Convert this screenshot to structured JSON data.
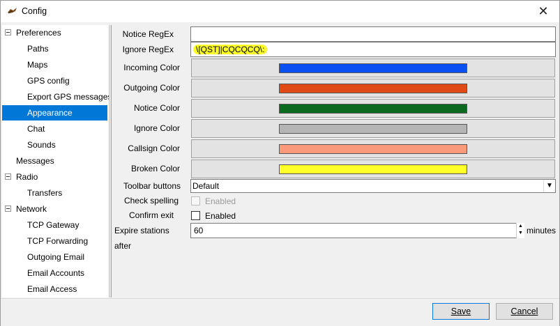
{
  "window": {
    "title": "Config",
    "close_symbol": "✕"
  },
  "tree": [
    {
      "label": "Preferences",
      "expander": true,
      "selected": false
    },
    {
      "label": "Paths",
      "expander": false,
      "selected": false
    },
    {
      "label": "Maps",
      "expander": false,
      "selected": false
    },
    {
      "label": "GPS config",
      "expander": false,
      "selected": false
    },
    {
      "label": "Export GPS messages",
      "expander": false,
      "selected": false
    },
    {
      "label": "Appearance",
      "expander": false,
      "selected": true
    },
    {
      "label": "Chat",
      "expander": false,
      "selected": false
    },
    {
      "label": "Sounds",
      "expander": false,
      "selected": false
    },
    {
      "label": "Messages",
      "expander": false,
      "selected": false
    },
    {
      "label": "Radio",
      "expander": true,
      "selected": false
    },
    {
      "label": "Transfers",
      "expander": false,
      "selected": false
    },
    {
      "label": "Network",
      "expander": true,
      "selected": false
    },
    {
      "label": "TCP Gateway",
      "expander": false,
      "selected": false
    },
    {
      "label": "TCP Forwarding",
      "expander": false,
      "selected": false
    },
    {
      "label": "Outgoing Email",
      "expander": false,
      "selected": false
    },
    {
      "label": "Email Accounts",
      "expander": false,
      "selected": false
    },
    {
      "label": "Email Access",
      "expander": false,
      "selected": false
    }
  ],
  "form": {
    "notice_regex": {
      "label": "Notice RegEx",
      "value": ""
    },
    "ignore_regex": {
      "label": "Ignore RegEx",
      "value": "\\[QST]|CQCQCQ\\:"
    },
    "colors": [
      {
        "label": "Incoming Color",
        "color": "#0a4ff2"
      },
      {
        "label": "Outgoing Color",
        "color": "#e04a17"
      },
      {
        "label": "Notice Color",
        "color": "#0b6a1f"
      },
      {
        "label": "Ignore Color",
        "color": "#b4b4b4"
      },
      {
        "label": "Callsign Color",
        "color": "#f99a7b"
      },
      {
        "label": "Broken Color",
        "color": "#ffff2a"
      }
    ],
    "toolbar_buttons": {
      "label": "Toolbar buttons",
      "value": "Default"
    },
    "check_spelling": {
      "label": "Check spelling",
      "checkbox_label": "Enabled"
    },
    "confirm_exit": {
      "label": "Confirm exit",
      "checkbox_label": "Enabled"
    },
    "expire_stations": {
      "label": "Expire stations after",
      "value": "60",
      "unit": "minutes"
    }
  },
  "buttons": {
    "save": "Save",
    "cancel": "Cancel"
  }
}
